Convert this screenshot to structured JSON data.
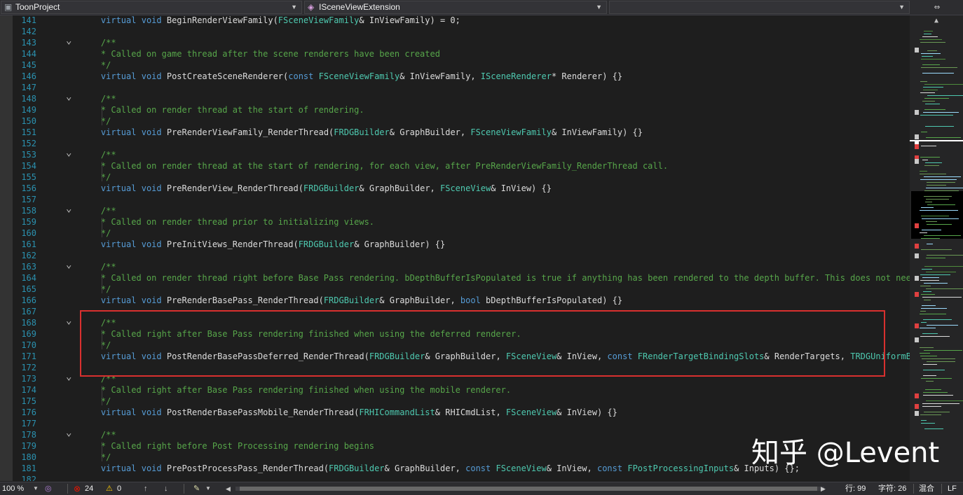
{
  "navbar": {
    "project": "ToonProject",
    "scope": "ISceneViewExtension",
    "member": ""
  },
  "code": {
    "lines": [
      {
        "n": "141",
        "fold": "",
        "t": [
          [
            "    ",
            "pl"
          ],
          [
            "virtual",
            "kw"
          ],
          [
            " ",
            "pl"
          ],
          [
            "void",
            "kw"
          ],
          [
            " BeginRenderViewFamily(",
            "pl"
          ],
          [
            "FSceneViewFamily",
            "ty"
          ],
          [
            "& InViewFamily) = 0;",
            "pl"
          ]
        ]
      },
      {
        "n": "142",
        "fold": "",
        "t": []
      },
      {
        "n": "143",
        "fold": "v",
        "t": [
          [
            "    ",
            "pl"
          ],
          [
            "/**",
            "cm"
          ]
        ]
      },
      {
        "n": "144",
        "fold": "",
        "t": [
          [
            "    ",
            "pl"
          ],
          [
            "* Called on game thread after the scene renderers have been created",
            "cm"
          ]
        ]
      },
      {
        "n": "145",
        "fold": "",
        "t": [
          [
            "    ",
            "pl"
          ],
          [
            "*/",
            "cm"
          ]
        ]
      },
      {
        "n": "146",
        "fold": "",
        "t": [
          [
            "    ",
            "pl"
          ],
          [
            "virtual",
            "kw"
          ],
          [
            " ",
            "pl"
          ],
          [
            "void",
            "kw"
          ],
          [
            " PostCreateSceneRenderer(",
            "pl"
          ],
          [
            "const",
            "kw"
          ],
          [
            " ",
            "pl"
          ],
          [
            "FSceneViewFamily",
            "ty"
          ],
          [
            "& InViewFamily, ",
            "pl"
          ],
          [
            "ISceneRenderer",
            "ty"
          ],
          [
            "* Renderer) {}",
            "pl"
          ]
        ]
      },
      {
        "n": "147",
        "fold": "",
        "t": []
      },
      {
        "n": "148",
        "fold": "v",
        "t": [
          [
            "    ",
            "pl"
          ],
          [
            "/**",
            "cm"
          ]
        ]
      },
      {
        "n": "149",
        "fold": "",
        "t": [
          [
            "    ",
            "pl"
          ],
          [
            "* Called on render thread at the start of rendering.",
            "cm"
          ]
        ]
      },
      {
        "n": "150",
        "fold": "",
        "t": [
          [
            "    ",
            "pl"
          ],
          [
            "*/",
            "cm"
          ]
        ]
      },
      {
        "n": "151",
        "fold": "",
        "t": [
          [
            "    ",
            "pl"
          ],
          [
            "virtual",
            "kw"
          ],
          [
            " ",
            "pl"
          ],
          [
            "void",
            "kw"
          ],
          [
            " PreRenderViewFamily_RenderThread(",
            "pl"
          ],
          [
            "FRDGBuilder",
            "ty"
          ],
          [
            "& GraphBuilder, ",
            "pl"
          ],
          [
            "FSceneViewFamily",
            "ty"
          ],
          [
            "& InViewFamily) {}",
            "pl"
          ]
        ]
      },
      {
        "n": "152",
        "fold": "",
        "t": []
      },
      {
        "n": "153",
        "fold": "v",
        "t": [
          [
            "    ",
            "pl"
          ],
          [
            "/**",
            "cm"
          ]
        ]
      },
      {
        "n": "154",
        "fold": "",
        "t": [
          [
            "    ",
            "pl"
          ],
          [
            "* Called on render thread at the start of rendering, for each view, after PreRenderViewFamily_RenderThread call.",
            "cm"
          ]
        ]
      },
      {
        "n": "155",
        "fold": "",
        "t": [
          [
            "    ",
            "pl"
          ],
          [
            "*/",
            "cm"
          ]
        ]
      },
      {
        "n": "156",
        "fold": "",
        "t": [
          [
            "    ",
            "pl"
          ],
          [
            "virtual",
            "kw"
          ],
          [
            " ",
            "pl"
          ],
          [
            "void",
            "kw"
          ],
          [
            " PreRenderView_RenderThread(",
            "pl"
          ],
          [
            "FRDGBuilder",
            "ty"
          ],
          [
            "& GraphBuilder, ",
            "pl"
          ],
          [
            "FSceneView",
            "ty"
          ],
          [
            "& InView) {}",
            "pl"
          ]
        ]
      },
      {
        "n": "157",
        "fold": "",
        "t": []
      },
      {
        "n": "158",
        "fold": "v",
        "t": [
          [
            "    ",
            "pl"
          ],
          [
            "/**",
            "cm"
          ]
        ]
      },
      {
        "n": "159",
        "fold": "",
        "t": [
          [
            "    ",
            "pl"
          ],
          [
            "* Called on render thread prior to initializing views.",
            "cm"
          ]
        ]
      },
      {
        "n": "160",
        "fold": "",
        "t": [
          [
            "    ",
            "pl"
          ],
          [
            "*/",
            "cm"
          ]
        ]
      },
      {
        "n": "161",
        "fold": "",
        "t": [
          [
            "    ",
            "pl"
          ],
          [
            "virtual",
            "kw"
          ],
          [
            " ",
            "pl"
          ],
          [
            "void",
            "kw"
          ],
          [
            " PreInitViews_RenderThread(",
            "pl"
          ],
          [
            "FRDGBuilder",
            "ty"
          ],
          [
            "& GraphBuilder) {}",
            "pl"
          ]
        ]
      },
      {
        "n": "162",
        "fold": "",
        "t": []
      },
      {
        "n": "163",
        "fold": "v",
        "t": [
          [
            "    ",
            "pl"
          ],
          [
            "/**",
            "cm"
          ]
        ]
      },
      {
        "n": "164",
        "fold": "",
        "t": [
          [
            "    ",
            "pl"
          ],
          [
            "* Called on render thread right before Base Pass rendering. bDepthBufferIsPopulated is true if anything has been rendered to the depth buffer. This does not need to",
            "cm"
          ]
        ]
      },
      {
        "n": "165",
        "fold": "",
        "t": [
          [
            "    ",
            "pl"
          ],
          [
            "*/",
            "cm"
          ]
        ]
      },
      {
        "n": "166",
        "fold": "",
        "t": [
          [
            "    ",
            "pl"
          ],
          [
            "virtual",
            "kw"
          ],
          [
            " ",
            "pl"
          ],
          [
            "void",
            "kw"
          ],
          [
            " PreRenderBasePass_RenderThread(",
            "pl"
          ],
          [
            "FRDGBuilder",
            "ty"
          ],
          [
            "& GraphBuilder, ",
            "pl"
          ],
          [
            "bool",
            "kw"
          ],
          [
            " bDepthBufferIsPopulated) {}",
            "pl"
          ]
        ]
      },
      {
        "n": "167",
        "fold": "",
        "t": []
      },
      {
        "n": "168",
        "fold": "v",
        "t": [
          [
            "    ",
            "pl"
          ],
          [
            "/**",
            "cm"
          ]
        ]
      },
      {
        "n": "169",
        "fold": "",
        "t": [
          [
            "    ",
            "pl"
          ],
          [
            "* Called right after Base Pass rendering finished when using the deferred renderer.",
            "cm"
          ]
        ]
      },
      {
        "n": "170",
        "fold": "",
        "t": [
          [
            "    ",
            "pl"
          ],
          [
            "*/",
            "cm"
          ]
        ]
      },
      {
        "n": "171",
        "fold": "",
        "t": [
          [
            "    ",
            "pl"
          ],
          [
            "virtual",
            "kw"
          ],
          [
            " ",
            "pl"
          ],
          [
            "void",
            "kw"
          ],
          [
            " PostRenderBasePassDeferred_RenderThread(",
            "pl"
          ],
          [
            "FRDGBuilder",
            "ty"
          ],
          [
            "& GraphBuilder, ",
            "pl"
          ],
          [
            "FSceneView",
            "ty"
          ],
          [
            "& InView, ",
            "pl"
          ],
          [
            "const",
            "kw"
          ],
          [
            " ",
            "pl"
          ],
          [
            "FRenderTargetBindingSlots",
            "ty"
          ],
          [
            "& RenderTargets, ",
            "pl"
          ],
          [
            "TRDGUniformBufferRef",
            "ty"
          ]
        ]
      },
      {
        "n": "172",
        "fold": "",
        "t": []
      },
      {
        "n": "173",
        "fold": "v",
        "t": [
          [
            "    ",
            "pl"
          ],
          [
            "/**",
            "cm"
          ]
        ]
      },
      {
        "n": "174",
        "fold": "",
        "t": [
          [
            "    ",
            "pl"
          ],
          [
            "* Called right after Base Pass rendering finished when using the mobile renderer.",
            "cm"
          ]
        ]
      },
      {
        "n": "175",
        "fold": "",
        "t": [
          [
            "    ",
            "pl"
          ],
          [
            "*/",
            "cm"
          ]
        ]
      },
      {
        "n": "176",
        "fold": "",
        "t": [
          [
            "    ",
            "pl"
          ],
          [
            "virtual",
            "kw"
          ],
          [
            " ",
            "pl"
          ],
          [
            "void",
            "kw"
          ],
          [
            " PostRenderBasePassMobile_RenderThread(",
            "pl"
          ],
          [
            "FRHICommandList",
            "ty"
          ],
          [
            "& RHICmdList, ",
            "pl"
          ],
          [
            "FSceneView",
            "ty"
          ],
          [
            "& InView) {}",
            "pl"
          ]
        ]
      },
      {
        "n": "177",
        "fold": "",
        "t": []
      },
      {
        "n": "178",
        "fold": "v",
        "t": [
          [
            "    ",
            "pl"
          ],
          [
            "/**",
            "cm"
          ]
        ]
      },
      {
        "n": "179",
        "fold": "",
        "t": [
          [
            "    ",
            "pl"
          ],
          [
            "* Called right before Post Processing rendering begins",
            "cm"
          ]
        ]
      },
      {
        "n": "180",
        "fold": "",
        "t": [
          [
            "    ",
            "pl"
          ],
          [
            "*/",
            "cm"
          ]
        ]
      },
      {
        "n": "181",
        "fold": "",
        "t": [
          [
            "    ",
            "pl"
          ],
          [
            "virtual",
            "kw"
          ],
          [
            " ",
            "pl"
          ],
          [
            "void",
            "kw"
          ],
          [
            " PrePostProcessPass_RenderThread(",
            "pl"
          ],
          [
            "FRDGBuilder",
            "ty"
          ],
          [
            "& GraphBuilder, ",
            "pl"
          ],
          [
            "const",
            "kw"
          ],
          [
            " ",
            "pl"
          ],
          [
            "FSceneView",
            "ty"
          ],
          [
            "& InView, ",
            "pl"
          ],
          [
            "const",
            "kw"
          ],
          [
            " ",
            "pl"
          ],
          [
            "FPostProcessingInputs",
            "ty"
          ],
          [
            "& Inputs) {};",
            "pl"
          ]
        ]
      },
      {
        "n": "182",
        "fold": "",
        "t": []
      }
    ]
  },
  "status": {
    "zoom": "100 %",
    "errors": "24",
    "warnings": "0",
    "line": "行: 99",
    "char": "字符: 26",
    "mode": "混合",
    "eol": "LF"
  },
  "watermark": "知乎 @Levent",
  "colors": {
    "keyword": "#569cd6",
    "type": "#4ec9b0",
    "comment": "#57a64a",
    "plain": "#dcdcdc",
    "line_number": "#2b91af",
    "highlight": "#d9302f"
  }
}
